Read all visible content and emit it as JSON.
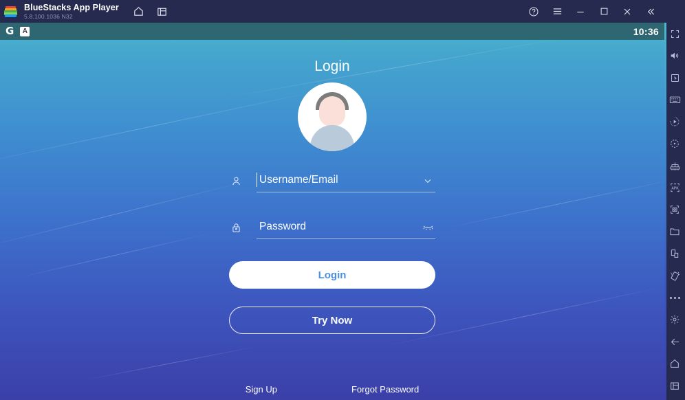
{
  "titlebar": {
    "app_name": "BlueStacks App Player",
    "version": "5.8.100.1036  N32",
    "logo_icon": "bluestacks-logo",
    "nav_icons": [
      {
        "name": "home-icon",
        "label": "Home"
      },
      {
        "name": "multi-instance-icon",
        "label": "Instances"
      }
    ],
    "window_icons": [
      {
        "name": "help-icon",
        "label": "Help"
      },
      {
        "name": "hamburger-menu-icon",
        "label": "Menu"
      },
      {
        "name": "minimize-icon",
        "label": "Minimize"
      },
      {
        "name": "maximize-icon",
        "label": "Maximize"
      },
      {
        "name": "close-icon",
        "label": "Close"
      },
      {
        "name": "collapse-sidebar-icon",
        "label": "Collapse"
      }
    ]
  },
  "statusbar": {
    "google_icon": "G",
    "app_icon_letter": "A",
    "clock": "10:36"
  },
  "login": {
    "title": "Login",
    "avatar_icon": "user-avatar-placeholder",
    "username": {
      "icon": "person-icon",
      "placeholder": "Username/Email",
      "value": "",
      "dropdown_icon": "chevron-down-icon"
    },
    "password": {
      "icon": "lock-icon",
      "placeholder": "Password",
      "value": "",
      "visibility_icon": "eye-closed-icon"
    },
    "login_button": "Login",
    "try_now_button": "Try Now",
    "sign_up_link": "Sign Up",
    "forgot_password_link": "Forgot Password"
  },
  "sidebar": {
    "items": [
      {
        "name": "fullscreen-icon",
        "label": "Full screen"
      },
      {
        "name": "volume-icon",
        "label": "Volume"
      },
      {
        "name": "pointer-icon",
        "label": "Game controls"
      },
      {
        "name": "keyboard-icon",
        "label": "Keyboard controls"
      },
      {
        "name": "macro-record-icon",
        "label": "Macro recorder"
      },
      {
        "name": "location-icon",
        "label": "Location"
      },
      {
        "name": "multi-instance-manager-icon",
        "label": "Multi-instance manager"
      },
      {
        "name": "install-apk-icon",
        "label": "Install APK"
      },
      {
        "name": "screenshot-icon",
        "label": "Screenshot"
      },
      {
        "name": "media-folder-icon",
        "label": "Media manager"
      },
      {
        "name": "copy-paste-icon",
        "label": "Copy to/from"
      },
      {
        "name": "shake-icon",
        "label": "Shake"
      },
      {
        "name": "more-options-icon",
        "label": "More"
      },
      {
        "name": "settings-gear-icon",
        "label": "Settings"
      },
      {
        "name": "back-arrow-icon",
        "label": "Back"
      },
      {
        "name": "home-nav-icon",
        "label": "Home"
      },
      {
        "name": "recent-apps-icon",
        "label": "Recent apps"
      }
    ]
  },
  "colors": {
    "chrome": "#262a4e",
    "statusbar": "#2e6672",
    "gradient_top": "#4cb8cf",
    "gradient_bottom": "#3b3fa8",
    "accent_blue": "#4a90e2"
  }
}
